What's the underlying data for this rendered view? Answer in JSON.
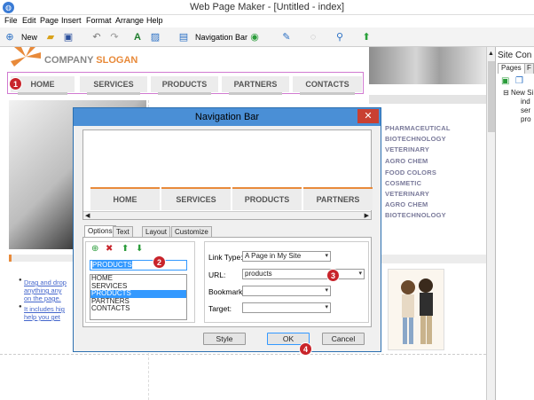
{
  "window": {
    "title": "Web Page Maker - [Untitled - index]"
  },
  "menu": [
    "File",
    "Edit",
    "Page",
    "Insert",
    "Format",
    "Arrange",
    "Help"
  ],
  "toolbar": {
    "new_label": "New",
    "navbar_label": "Navigation Bar"
  },
  "page": {
    "company": "COMPANY",
    "slogan": "SLOGAN",
    "nav": [
      "HOME",
      "SERVICES",
      "PRODUCTS",
      "PARTNERS",
      "CONTACTS"
    ],
    "categories": [
      "PHARMACEUTICAL",
      "BIOTECHNOLOGY",
      "VETERINARY",
      "AGRO CHEM",
      "FOOD COLORS",
      "COSMETIC",
      "VETERINARY",
      "AGRO CHEM",
      "BIOTECHNOLOGY"
    ],
    "bullets": [
      [
        "Drag and drop",
        "anything any",
        "on the page."
      ],
      [
        "It includes hig",
        "help you get"
      ]
    ]
  },
  "site_panel": {
    "title": "Site Con",
    "tabs": [
      "Pages",
      "F"
    ],
    "tree": [
      "New Si",
      "ind",
      "ser",
      "pro"
    ]
  },
  "dialog": {
    "title": "Navigation Bar",
    "preview_items": [
      "HOME",
      "SERVICES",
      "PRODUCTS",
      "PARTNERS"
    ],
    "tabs": [
      "Options",
      "Text",
      "Layout",
      "Customize"
    ],
    "item_name_value": "PRODUCTS",
    "items": [
      "HOME",
      "SERVICES",
      "PRODUCTS",
      "PARTNERS",
      "CONTACTS"
    ],
    "selected_item": "PRODUCTS",
    "link_type_label": "Link Type:",
    "link_type_value": "A Page in My Site",
    "url_label": "URL:",
    "url_value": "products",
    "bookmark_label": "Bookmark:",
    "target_label": "Target:",
    "style_button": "Style",
    "ok_button": "OK",
    "cancel_button": "Cancel"
  },
  "badges": [
    "1",
    "2",
    "3",
    "4"
  ],
  "colors": {
    "accent_orange": "#e88a3a",
    "slogan": "#e88a3a",
    "selection": "#3399ff",
    "badge": "#c8242b"
  }
}
